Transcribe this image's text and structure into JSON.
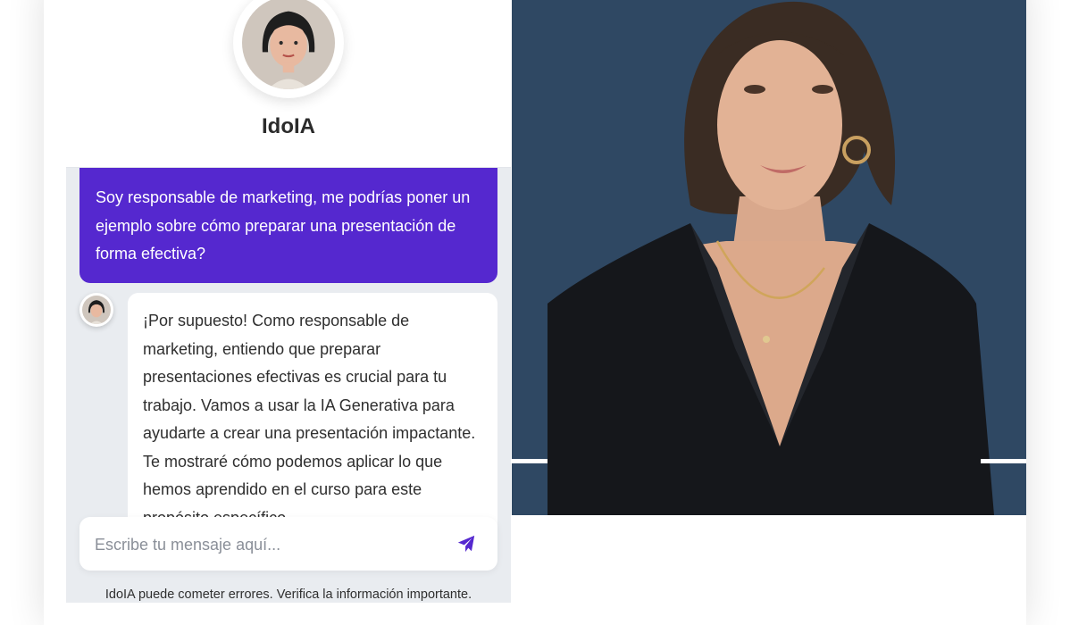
{
  "bot": {
    "name": "IdoIA"
  },
  "messages": {
    "user": "Soy responsable de marketing, me podrías poner un ejemplo sobre cómo preparar una presentación de forma efectiva?",
    "bot": "¡Por supuesto! Como responsable de marketing, entiendo que preparar presentaciones efectivas es crucial para tu trabajo. Vamos a usar la IA Generativa para ayudarte a crear una presentación impactante. Te mostraré cómo podemos aplicar lo que hemos aprendido en el curso para este propósito específico."
  },
  "composer": {
    "placeholder": "Escribe tu mensaje aquí...",
    "send_icon": "paper-plane-icon"
  },
  "footer": {
    "disclaimer": "IdoIA puede cometer errores. Verifica la información importante."
  },
  "colors": {
    "accent": "#5528cf",
    "video_background": "#2f4863",
    "chat_background": "#e9ecf0"
  }
}
